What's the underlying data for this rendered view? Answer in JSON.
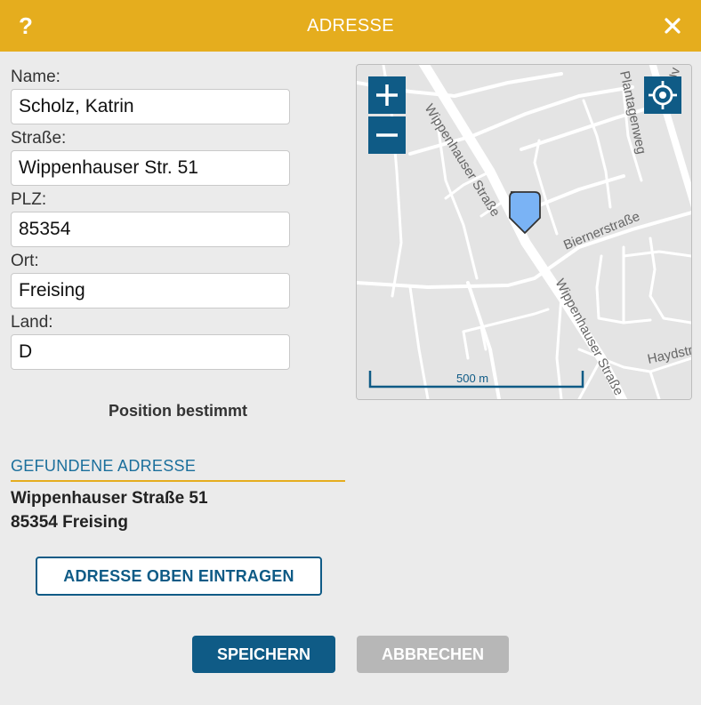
{
  "dialog": {
    "title": "ADRESSE",
    "help_label": "?"
  },
  "form": {
    "name": {
      "label": "Name:",
      "value": "Scholz, Katrin"
    },
    "street": {
      "label": "Straße:",
      "value": "Wippenhauser Str. 51"
    },
    "zip": {
      "label": "PLZ:",
      "value": "85354"
    },
    "city": {
      "label": "Ort:",
      "value": "Freising"
    },
    "country": {
      "label": "Land:",
      "value": "D"
    }
  },
  "status_text": "Position bestimmt",
  "found": {
    "heading": "GEFUNDENE ADRESSE",
    "line1": "Wippenhauser Straße 51",
    "line2": "85354 Freising"
  },
  "buttons": {
    "apply_address": "ADRESSE OBEN EINTRAGEN",
    "save": "SPEICHERN",
    "cancel": "ABBRECHEN"
  },
  "map": {
    "scale_label": "500 m",
    "streets": {
      "wippenhauser_upper": "Wippenhauser Straße",
      "wippenhauser_lower": "Wippenhauser Straße",
      "biernerstrasse": "Biernerstraße",
      "plantagenweg": "Plantagenweg",
      "haydstrasse": "Haydstr",
      "top_right_fragment": "Uv"
    },
    "marker_color": "#7ab3f5"
  },
  "colors": {
    "accent": "#e5ad1e",
    "primary": "#0f5b86",
    "disabled": "#b7b7b7"
  },
  "icons": {
    "close": "close-icon",
    "zoom_in": "plus-icon",
    "zoom_out": "minus-icon",
    "locate": "crosshair-icon",
    "marker": "map-pin-icon"
  }
}
